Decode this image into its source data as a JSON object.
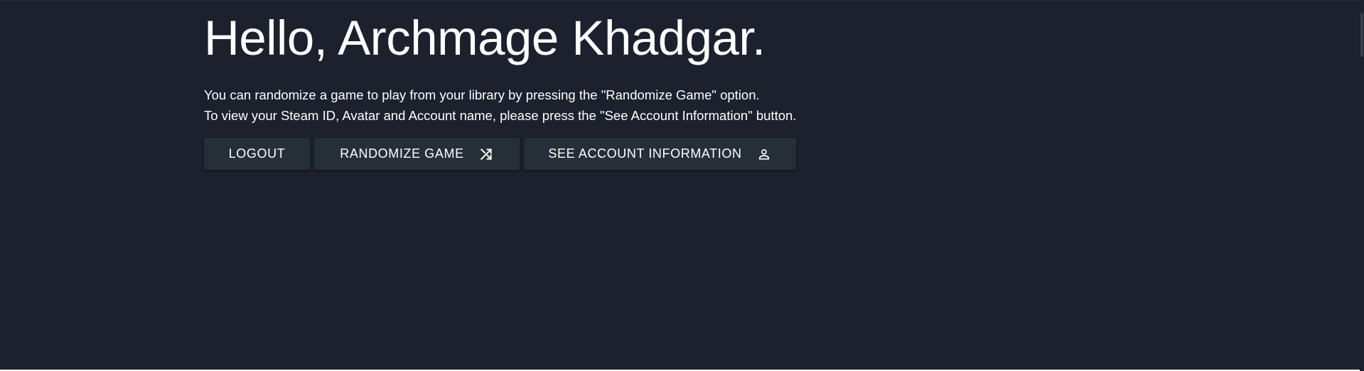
{
  "page": {
    "greeting": "Hello, Archmage Khadgar.",
    "description": [
      "You can randomize a game to play from your library by pressing the \"Randomize Game\" option.",
      "To view your Steam ID, Avatar and Account name, please press the \"See Account Information\" button."
    ]
  },
  "actions": {
    "logout_label": "Logout",
    "randomize_label": "Randomize Game",
    "randomize_icon": "shuffle-icon",
    "account_label": "See Account Information",
    "account_icon": "person-icon"
  },
  "colors": {
    "background": "#1c212d",
    "button": "#262f38",
    "text": "#ffffff"
  }
}
